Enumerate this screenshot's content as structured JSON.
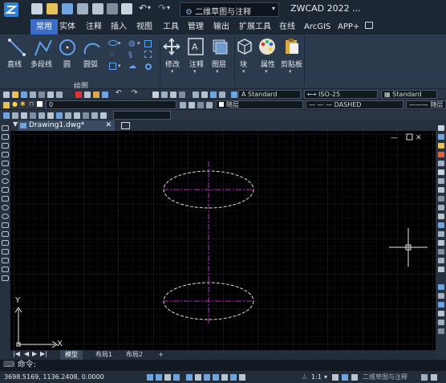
{
  "title_bar": {
    "doc_combo": "二维草图与注释",
    "app_title": "ZWCAD 2022 ..."
  },
  "menu": {
    "tabs": [
      "常用",
      "实体",
      "注释",
      "插入",
      "视图",
      "工具",
      "管理",
      "输出",
      "扩展工具",
      "在线",
      "ArcGIS",
      "APP+"
    ]
  },
  "ribbon": {
    "draw_tools": [
      "直线",
      "多段线",
      "圆",
      "圆弧"
    ],
    "big_tools": [
      "修改",
      "注释",
      "图层",
      "块",
      "属性",
      "剪贴板"
    ],
    "group_label": "绘图"
  },
  "toolbars": {
    "text_style": "Standard",
    "dim_style": "ISO-25",
    "table_style": "Standard",
    "layer_value": "0",
    "color_combo": "随层",
    "linetype_combo": "— — — DASHED",
    "lineweight_combo": "——— 随层"
  },
  "document": {
    "tab_label": "Drawing1.dwg*",
    "axis_y": "Y",
    "axis_x": "X"
  },
  "layout_tabs": [
    "模型",
    "布局1",
    "布局2",
    "+"
  ],
  "command_line": {
    "prompt": "命令:"
  },
  "status_bar": {
    "coordinates": "3698.5169, 1136.2408, 0.0000",
    "scale": "1:1",
    "workspace": "二维草图与注释"
  },
  "colors": {
    "accent": "#3b6dc6",
    "canvas": "#000000",
    "grid": "#1f2630",
    "ellipse": "#d9d9d9",
    "centerline": "#c01fc0"
  }
}
